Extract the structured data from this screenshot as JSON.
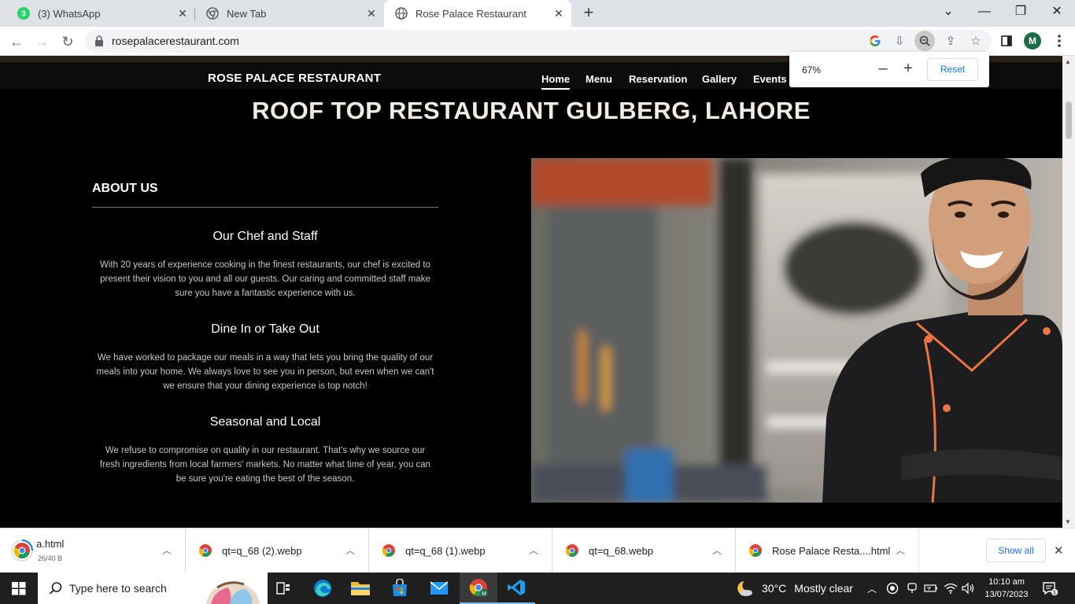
{
  "browser": {
    "tabs": [
      {
        "title": "(3) WhatsApp",
        "badge": "3",
        "icon": "whatsapp-icon",
        "active": false
      },
      {
        "title": "New Tab",
        "icon": "chrome-icon",
        "active": false
      },
      {
        "title": "Rose Palace Restaurant",
        "icon": "globe-icon",
        "active": true
      }
    ],
    "url": "rosepalacerestaurant.com",
    "profile_initial": "M",
    "zoom": {
      "percent": "67%",
      "reset_label": "Reset",
      "minus": "–",
      "plus": "+"
    }
  },
  "site": {
    "brand": "ROSE PALACE RESTAURANT",
    "nav": [
      "Home",
      "Menu",
      "Reservation",
      "Gallery",
      "Events"
    ],
    "active_nav": "Home",
    "hero_title": "ROOF TOP RESTAURANT GULBERG, LAHORE",
    "about": {
      "heading": "ABOUT US",
      "sections": [
        {
          "title": "Our Chef and Staff",
          "text": "With 20 years of experience cooking in the finest restaurants, our chef is excited to present their vision to you and all our guests. Our caring and committed staff make sure you have a fantastic experience with us."
        },
        {
          "title": "Dine In or Take Out",
          "text": "We have worked to package our meals in a way that lets you bring the quality of our meals into your home. We always love to see you in person, but even when we can't we ensure that your dining experience is top notch!"
        },
        {
          "title": "Seasonal and Local",
          "text": "We refuse to compromise on quality in our restaurant. That's why we source our fresh ingredients from local farmers' markets. No matter what time of year, you can be sure you're eating the best of the season."
        }
      ]
    }
  },
  "downloads": {
    "items": [
      {
        "name": "a.html",
        "size": "26/40 B"
      },
      {
        "name": "qt=q_68 (2).webp"
      },
      {
        "name": "qt=q_68 (1).webp"
      },
      {
        "name": "qt=q_68.webp"
      },
      {
        "name": "Rose Palace Resta....html"
      }
    ],
    "show_all": "Show all"
  },
  "taskbar": {
    "search_placeholder": "Type here to search",
    "weather": {
      "temp": "30°C",
      "condition": "Mostly clear"
    },
    "time": "10:10 am",
    "date": "13/07/2023",
    "notification_count": "1"
  },
  "colors": {
    "page_bg": "#000000",
    "nav_bg": "#0c0c0c",
    "link_blue": "#1a73e8",
    "taskbar_bg": "#1f1f1f"
  }
}
